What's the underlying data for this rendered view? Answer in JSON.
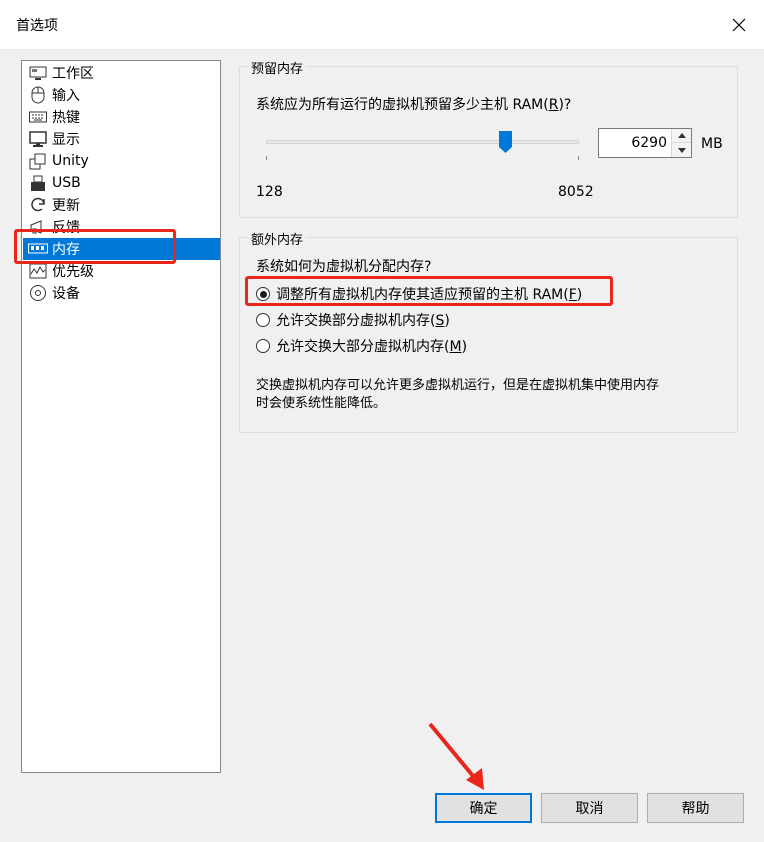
{
  "window": {
    "title": "首选项"
  },
  "nav": {
    "items": [
      {
        "label": "工作区",
        "icon": "workspace-icon"
      },
      {
        "label": "输入",
        "icon": "mouse-icon"
      },
      {
        "label": "热键",
        "icon": "keyboard-icon"
      },
      {
        "label": "显示",
        "icon": "monitor-icon"
      },
      {
        "label": "Unity",
        "icon": "unity-windows-icon"
      },
      {
        "label": "USB",
        "icon": "usb-icon"
      },
      {
        "label": "更新",
        "icon": "refresh-icon"
      },
      {
        "label": "反馈",
        "icon": "megaphone-icon"
      },
      {
        "label": "内存",
        "icon": "memory-chip-icon"
      },
      {
        "label": "优先级",
        "icon": "priority-graph-icon"
      },
      {
        "label": "设备",
        "icon": "device-disc-icon"
      }
    ],
    "selected_index": 8
  },
  "reserved_memory": {
    "group_label": "预留内存",
    "question_prefix": "系统应为所有运行的虚拟机预留多少主机 RAM(",
    "question_hotkey": "R",
    "question_suffix": ")?",
    "slider_min_label": "128",
    "slider_max_label": "8052",
    "slider_min": 128,
    "slider_max": 8052,
    "slider_value": 6290,
    "spin_value": "6290",
    "unit": "MB"
  },
  "extra_memory": {
    "group_label": "额外内存",
    "question": "系统如何为虚拟机分配内存?",
    "options": [
      {
        "prefix": "调整所有虚拟机内存使其适应预留的主机 RAM(",
        "hotkey": "F",
        "suffix": ")",
        "checked": true
      },
      {
        "prefix": "允许交换部分虚拟机内存(",
        "hotkey": "S",
        "suffix": ")",
        "checked": false
      },
      {
        "prefix": "允许交换大部分虚拟机内存(",
        "hotkey": "M",
        "suffix": ")",
        "checked": false
      }
    ],
    "note_line1": "交换虚拟机内存可以允许更多虚拟机运行，但是在虚拟机集中使用内存",
    "note_line2": "时会使系统性能降低。"
  },
  "buttons": {
    "ok": "确定",
    "cancel": "取消",
    "help": "帮助"
  },
  "colors": {
    "selection": "#0078d7",
    "highlight": "#e8261c",
    "thumb": "#0078d7"
  }
}
